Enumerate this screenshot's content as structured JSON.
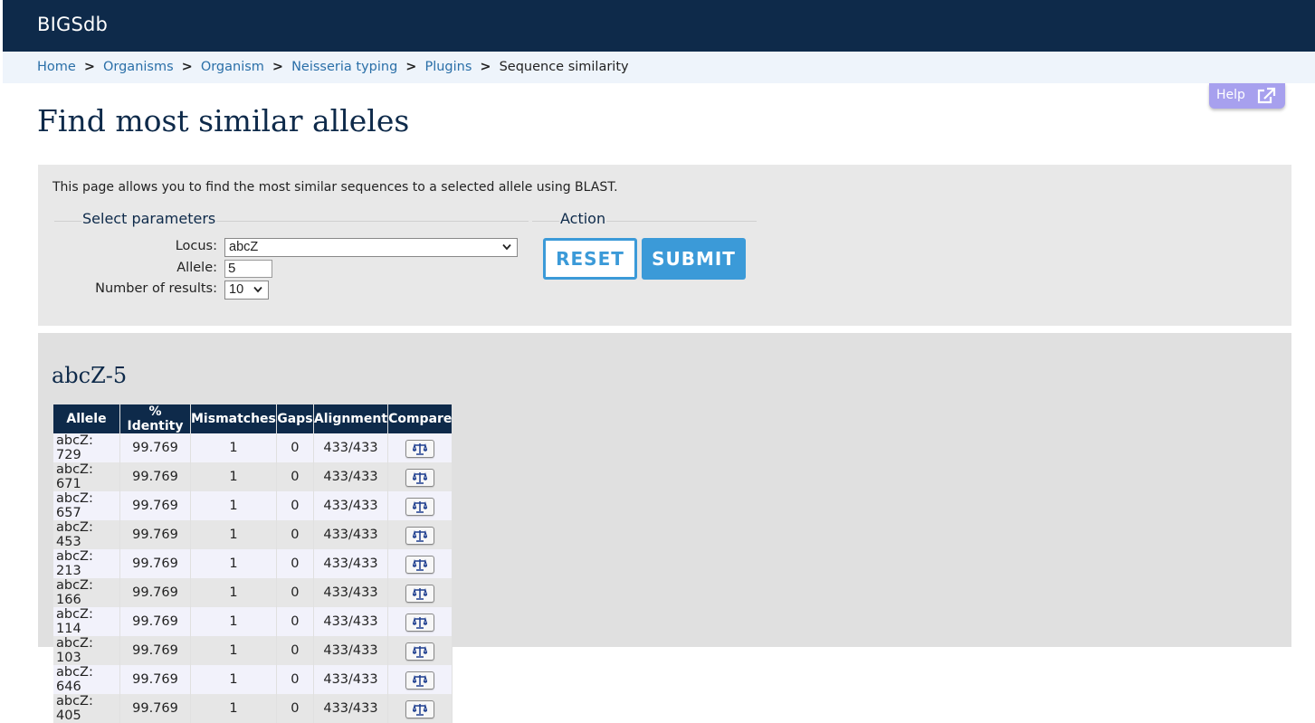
{
  "app": {
    "brand": "BIGSdb"
  },
  "breadcrumb": {
    "items": [
      "Home",
      "Organisms",
      "Organism",
      "Neisseria typing",
      "Plugins"
    ],
    "current": "Sequence similarity",
    "separator": ">"
  },
  "help": {
    "label": "Help",
    "icon": "external-link-icon"
  },
  "page": {
    "title": "Find most similar alleles"
  },
  "intro": {
    "text": "This page allows you to find the most similar sequences to a selected allele using BLAST."
  },
  "params": {
    "legend": "Select parameters",
    "locus_label": "Locus:",
    "locus_value": "abcZ",
    "allele_label": "Allele:",
    "allele_value": "5",
    "results_label": "Number of results:",
    "results_value": "10"
  },
  "action": {
    "legend": "Action",
    "reset_label": "RESET",
    "submit_label": "SUBMIT"
  },
  "colors": {
    "header": "#0e2a4a",
    "accent": "#3b9ad8",
    "help": "#a7a0ee",
    "link": "#2a6fa8"
  },
  "results": {
    "title": "abcZ-5",
    "columns": [
      "Allele",
      "% Identity",
      "Mismatches",
      "Gaps",
      "Alignment",
      "Compare"
    ],
    "compare_icon": "balance-scale-icon",
    "rows": [
      {
        "allele": "abcZ: 729",
        "identity": "99.769",
        "mismatches": "1",
        "gaps": "0",
        "alignment": "433/433"
      },
      {
        "allele": "abcZ: 671",
        "identity": "99.769",
        "mismatches": "1",
        "gaps": "0",
        "alignment": "433/433"
      },
      {
        "allele": "abcZ: 657",
        "identity": "99.769",
        "mismatches": "1",
        "gaps": "0",
        "alignment": "433/433"
      },
      {
        "allele": "abcZ: 453",
        "identity": "99.769",
        "mismatches": "1",
        "gaps": "0",
        "alignment": "433/433"
      },
      {
        "allele": "abcZ: 213",
        "identity": "99.769",
        "mismatches": "1",
        "gaps": "0",
        "alignment": "433/433"
      },
      {
        "allele": "abcZ: 166",
        "identity": "99.769",
        "mismatches": "1",
        "gaps": "0",
        "alignment": "433/433"
      },
      {
        "allele": "abcZ: 114",
        "identity": "99.769",
        "mismatches": "1",
        "gaps": "0",
        "alignment": "433/433"
      },
      {
        "allele": "abcZ: 103",
        "identity": "99.769",
        "mismatches": "1",
        "gaps": "0",
        "alignment": "433/433"
      },
      {
        "allele": "abcZ: 646",
        "identity": "99.769",
        "mismatches": "1",
        "gaps": "0",
        "alignment": "433/433"
      },
      {
        "allele": "abcZ: 405",
        "identity": "99.769",
        "mismatches": "1",
        "gaps": "0",
        "alignment": "433/433"
      }
    ]
  }
}
